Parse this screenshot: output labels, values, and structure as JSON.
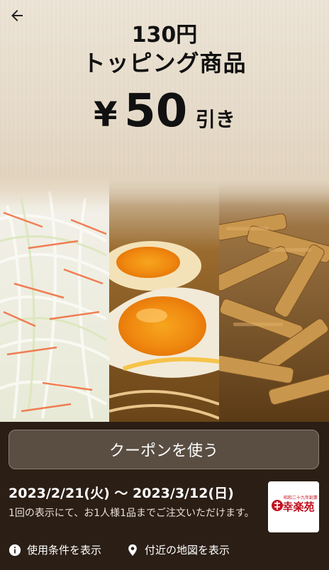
{
  "offer": {
    "line1": "130円",
    "line2": "トッピング商品",
    "currency": "¥",
    "amount": "50",
    "suffix": "引き"
  },
  "actions": {
    "use_coupon": "クーポンを使う"
  },
  "details": {
    "period": "2023/2/21(火) 〜 2023/3/12(日)",
    "note": "1回の表示にて、お1人様1品までご注文いただけます。"
  },
  "links": {
    "terms": "使用条件を表示",
    "map": "付近の地図を表示"
  },
  "brand": {
    "name": "幸楽苑",
    "tagline": "昭和二十九年創業"
  },
  "icons": {
    "back": "back-arrow-icon",
    "info": "info-icon",
    "pin": "map-pin-icon"
  },
  "colors": {
    "panel_bg": "#2b1e15",
    "button_bg": "#5a4e43",
    "logo_red": "#c1121f"
  }
}
